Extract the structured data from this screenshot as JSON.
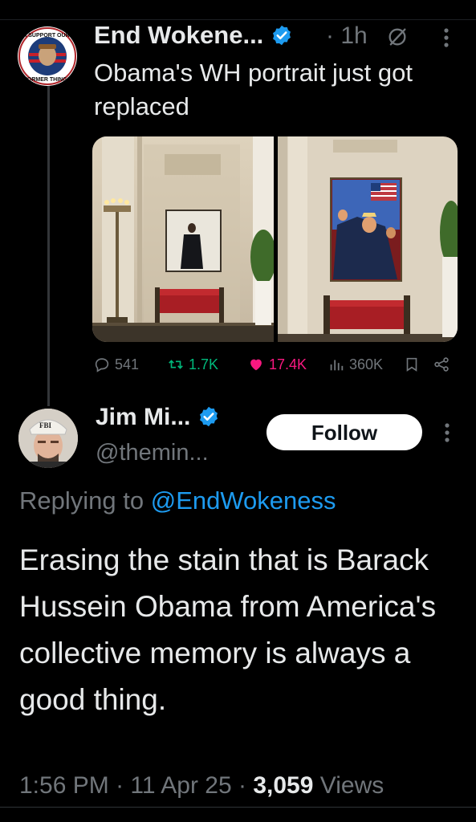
{
  "tweet": {
    "author_name": "End Wokene...",
    "separator": "·",
    "time_ago": "1h",
    "text": "Obama's WH portrait just got replaced",
    "avatar_text_top": "I SUPPORT OUR",
    "avatar_text_bottom": "FORMER THINGS",
    "metrics": {
      "replies": "541",
      "reposts": "1.7K",
      "likes": "17.4K",
      "views": "360K"
    },
    "colors": {
      "like": "#f91880",
      "repost": "#00ba7c",
      "verified": "#1d9bf0",
      "muted": "#71767b"
    }
  },
  "reply": {
    "author_name": "Jim Mi...",
    "handle": "@themin...",
    "follow_label": "Follow",
    "avatar_cap_text": "FBI",
    "replying_prefix": "Replying to",
    "replying_mention": "@EndWokeness",
    "text": "Erasing the stain that is Barack Hussein Obama from America's collective memory is always a good thing.",
    "time": "1:56 PM",
    "date": "11 Apr 25",
    "views_count": "3,059",
    "views_label": "Views"
  }
}
